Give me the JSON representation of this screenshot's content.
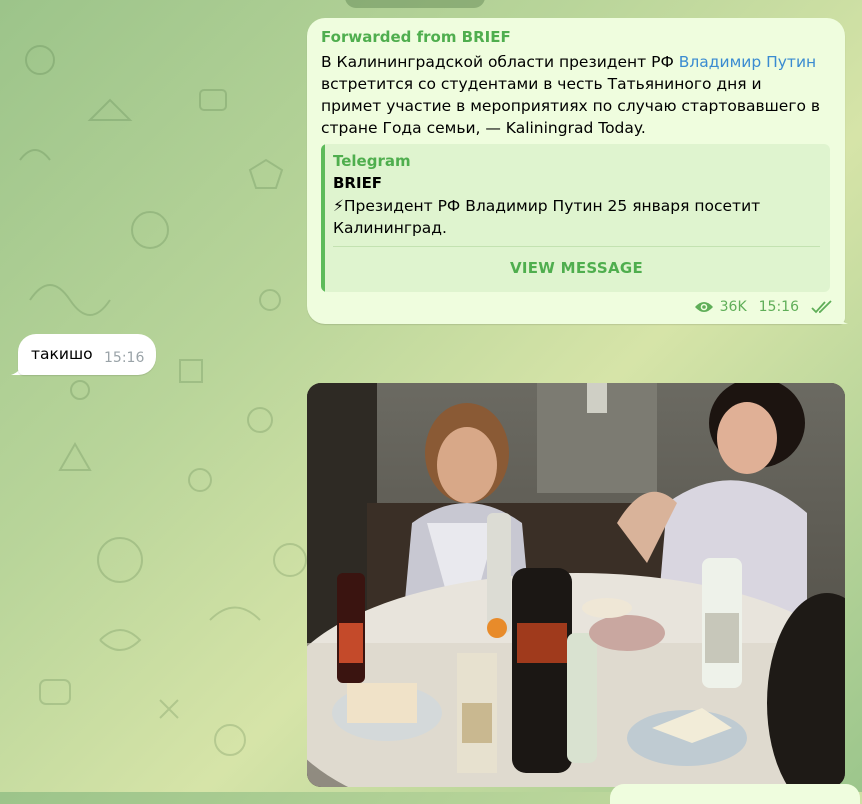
{
  "outgoing_message": {
    "forwarded_from": "Forwarded from BRIEF",
    "text_before_link": "В Калининградской области президент РФ ",
    "link_text": "Владимир Путин",
    "text_after_link": " встретится со студентами в честь Татьяниного дня и примет участие в мероприятиях по случаю стартовавшего в стране Года семьи, — Kaliningrad Today.",
    "quote": {
      "source": "Telegram",
      "channel": "BRIEF",
      "emoji": "⚡",
      "text": "Президент РФ Владимир Путин 25 января посетит Калининград."
    },
    "view_button": "VIEW MESSAGE",
    "views": "36K",
    "time": "15:16",
    "status_icon": "double-check-icon",
    "views_icon": "eye-icon"
  },
  "incoming_message": {
    "text": "такишо",
    "time": "15:16"
  },
  "photo_message": {
    "description_icon": "photo-image"
  },
  "colors": {
    "outgoing_bg": "#effdde",
    "accent_green": "#4fae4e",
    "link_blue": "#3a8bd1",
    "incoming_bg": "#ffffff"
  }
}
